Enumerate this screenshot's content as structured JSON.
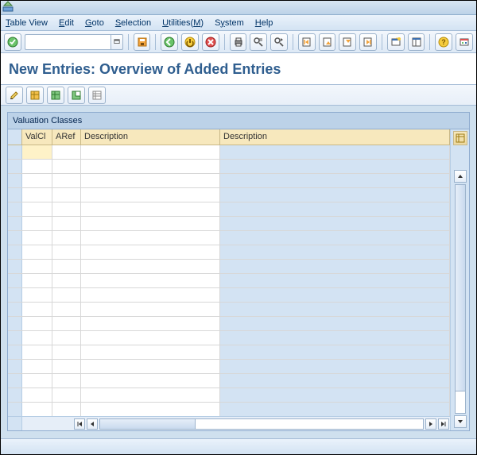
{
  "menu": {
    "table_view": "Table View",
    "edit": "Edit",
    "goto": "Goto",
    "selection": "Selection",
    "utilities": "Utilities(M)",
    "system": "System",
    "help": "Help"
  },
  "command_value": "",
  "heading_title": "New Entries: Overview of Added Entries",
  "panel_title": "Valuation Classes",
  "columns": {
    "valcl": "ValCl",
    "aref": "ARef",
    "desc1": "Description",
    "desc2": "Description"
  },
  "icons": {
    "app": "app-icon",
    "ok": "ok-check-icon",
    "dropdown": "dropdown-icon",
    "save": "save-icon",
    "back": "back-icon",
    "exit": "exit-icon",
    "cancel": "cancel-icon",
    "print": "print-icon",
    "find": "find-icon",
    "find_next": "find-next-icon",
    "first": "first-page-icon",
    "prev": "prev-page-icon",
    "next": "next-page-icon",
    "last": "last-page-icon",
    "new_session": "new-session-icon",
    "layout": "layout-icon",
    "help": "help-icon",
    "customize": "customize-icon",
    "st_change": "change-icon",
    "st_sel_all": "select-all-icon",
    "st_sel_block": "select-block-icon",
    "st_desel": "deselect-all-icon",
    "st_config": "configure-icon",
    "grid_corner": "grid-settings-icon",
    "scroll_left_end": "scroll-first-icon",
    "scroll_left": "scroll-left-icon",
    "scroll_right": "scroll-right-icon",
    "scroll_right_end": "scroll-last-icon",
    "scroll_up": "scroll-up-icon",
    "scroll_down": "scroll-down-icon"
  }
}
